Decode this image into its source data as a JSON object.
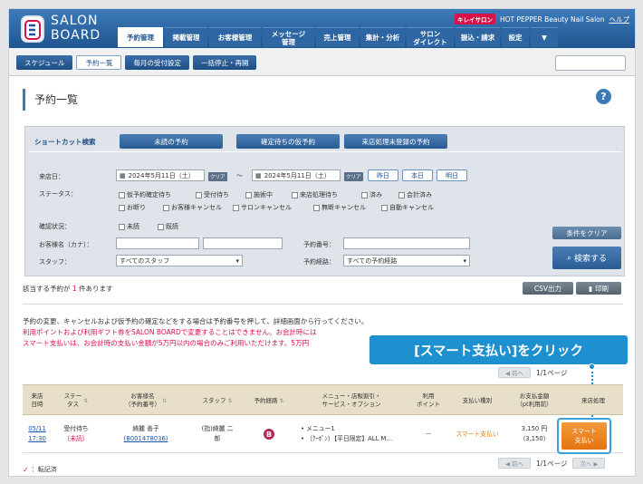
{
  "header": {
    "brand_line1": "SALON",
    "brand_line2": "BOARD",
    "kirei_badge": "キレイサロン",
    "salon_name": "HOT PEPPER Beauty Nail Salon",
    "help": "ヘルプ",
    "nav": [
      "予約管理",
      "掲載管理",
      "お客様管理",
      "メッセージ\n管理",
      "売上管理",
      "集計・分析",
      "サロン\nダイレクト",
      "振込・請求",
      "設定",
      "▼"
    ]
  },
  "subnav": [
    "スケジュール",
    "予約一覧",
    "毎月の受付設定",
    "一括停止・再開"
  ],
  "page_title": "予約一覧",
  "help_icon": "?",
  "shortcut": {
    "label": "ショートカット検索",
    "buttons": [
      "未読の予約",
      "確定待ちの仮予約",
      "来店処理未登録の予約"
    ]
  },
  "search": {
    "visit_date_label": "来店日：",
    "date_from": "2024年5月11日（土）",
    "date_to": "2024年5月11日（土）",
    "clear": "クリア",
    "tilde": "〜",
    "day_buttons": [
      "昨日",
      "本日",
      "明日"
    ],
    "status_label": "ステータス：",
    "status_row1": [
      "仮予約確定待ち",
      "受付待ち",
      "施術中",
      "来店処理待ち",
      "済み",
      "会計済み"
    ],
    "status_row2": [
      "お断り",
      "お客様キャンセル",
      "サロンキャンセル",
      "無断キャンセル",
      "自動キャンセル"
    ],
    "confirm_label": "確認状況：",
    "confirm_opts": [
      "未読",
      "既読"
    ],
    "name_label": "お客様名（カナ）：",
    "reserve_no_label": "予約番号：",
    "staff_label": "スタッフ：",
    "staff_value": "すべてのスタッフ",
    "route_label": "予約経路：",
    "route_value": "すべての予約経路",
    "clear_conditions": "条件をクリア",
    "search_button": "検索する"
  },
  "results": {
    "count_prefix": "該当する予約が",
    "count": "1",
    "count_suffix": "件あります",
    "csv": "CSV出力",
    "print": "印刷"
  },
  "notes": {
    "line1": "予約の変更、キャンセルおよび仮予約の確定などをする場合は予約番号を押して、詳細画面から行ってください。",
    "line2": "利用ポイントおよび利用ギフト券をSALON BOARDで変更することはできません。お会計時には",
    "line3": "スマート支払いは、お会計時の支払い金額が5万円以内の場合のみご利用いただけます。5万円"
  },
  "callout": "[スマート支払い]をクリック",
  "pager": {
    "prev": "◀ 前へ",
    "page": "1/1ページ",
    "next": "次へ ▶"
  },
  "table": {
    "headers": [
      "来店\n日時",
      "ステー\nタス",
      "お客様名\n（予約番号）",
      "スタッフ",
      "予約経路",
      "メニュー・店販割引・\nサービス・オプション",
      "利用\nポイント",
      "支払い種別",
      "お支払金額\n（pt利用前）",
      "来店処理"
    ],
    "row": {
      "date": "05/11",
      "time": "17:30",
      "status": "受付待ち",
      "status_sub": "（未読）",
      "customer": "綺麗 善子",
      "reserve_no": "(B001478036)",
      "staff": "(指)綺麗 二\n郎",
      "route_icon": "B",
      "menu1": "メニュー1",
      "menu2": "（ｸｰﾎﾟﾝ）【平日限定】ALL M…",
      "points": "－",
      "payment_type": "スマート支払い",
      "amount": "3,150 円",
      "amount_sub": "（3,150）",
      "action": "スマート\n支払い"
    }
  },
  "legend": {
    "mark": "✓",
    "text": "：転記済"
  }
}
